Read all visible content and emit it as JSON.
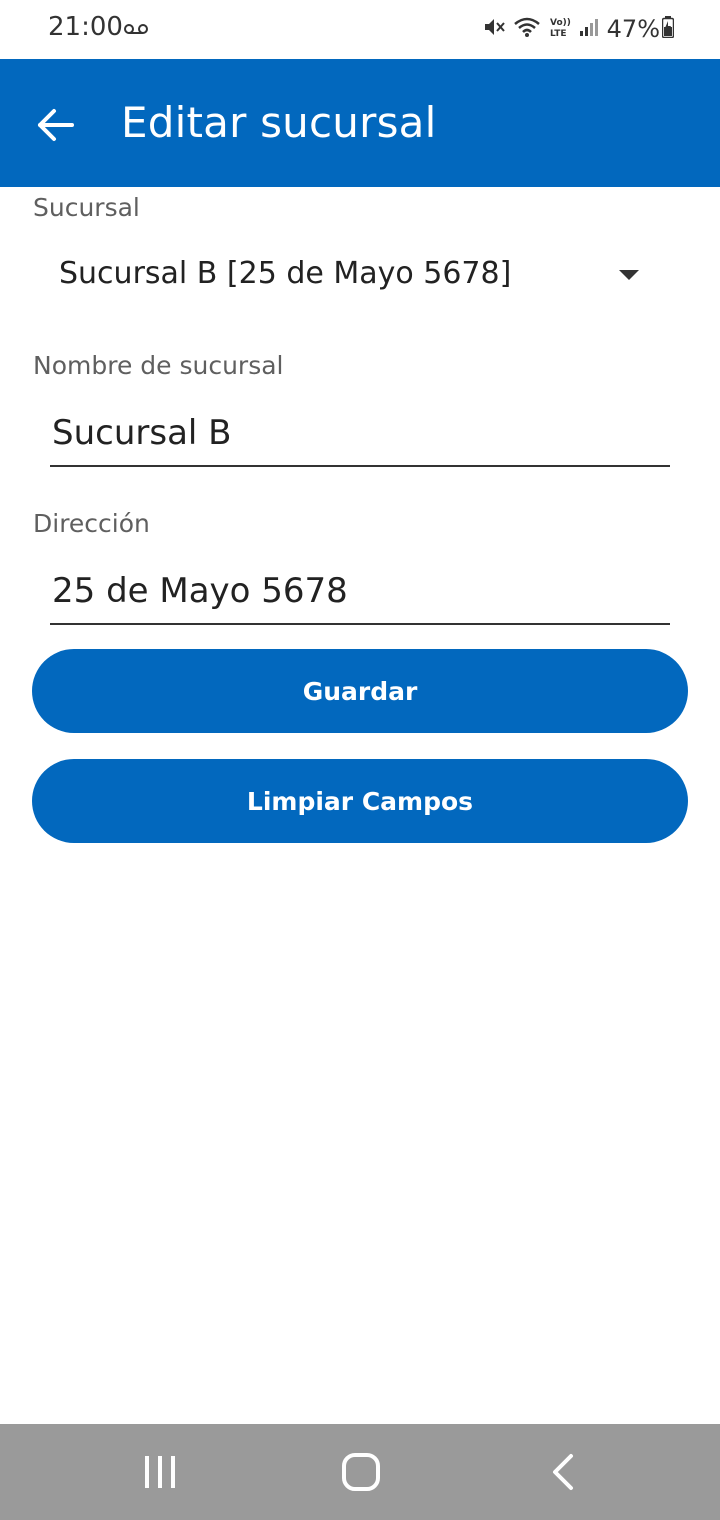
{
  "status_bar": {
    "time": "21:00",
    "battery": "47%",
    "icons": [
      "voicemail-icon",
      "mute-icon",
      "wifi-icon",
      "volte-icon",
      "signal-icon",
      "battery-icon"
    ]
  },
  "app_bar": {
    "title": "Editar sucursal",
    "back_icon": "arrow-left-icon",
    "color": "#0268be"
  },
  "form": {
    "branch_label": "Sucursal",
    "branch_selected": "Sucursal B [25 de Mayo 5678]",
    "name_label": "Nombre de sucursal",
    "name_value": "Sucursal B",
    "address_label": "Dirección",
    "address_value": "25 de Mayo 5678"
  },
  "buttons": {
    "save": "Guardar",
    "clear": "Limpiar Campos"
  },
  "nav_bar": {
    "icons": [
      "recent-apps-icon",
      "home-icon",
      "back-nav-icon"
    ]
  }
}
